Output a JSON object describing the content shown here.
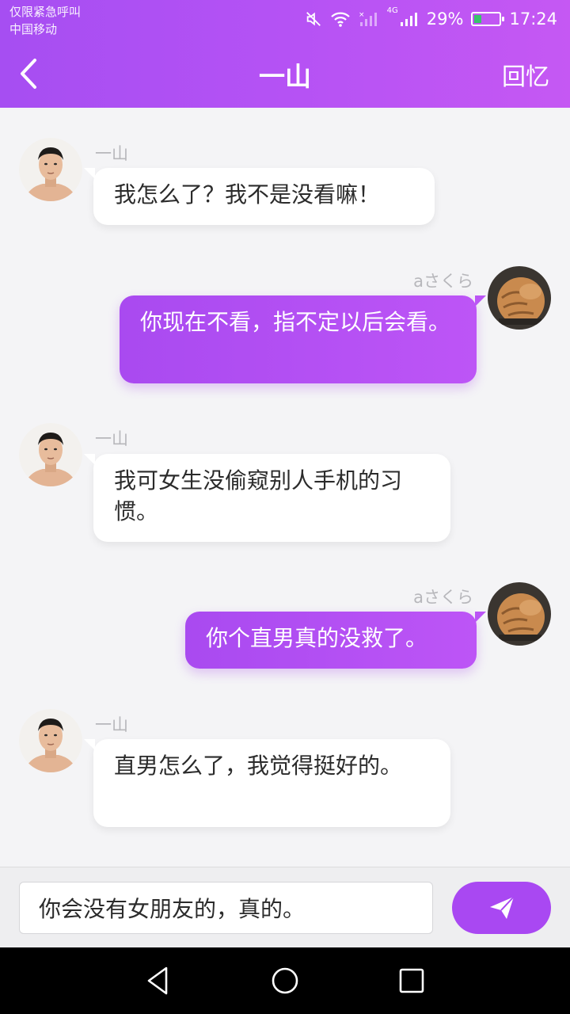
{
  "status_bar": {
    "line1": "仅限紧急呼叫",
    "line2": "中国移动",
    "network": "4G",
    "battery": "29%",
    "time": "17:24",
    "battery_level": 0.29
  },
  "header": {
    "title": "一山",
    "right_action": "回忆"
  },
  "messages": [
    {
      "side": "left",
      "sender": "一山",
      "text": "我怎么了？我不是没看嘛！"
    },
    {
      "side": "right",
      "sender": "aさくら",
      "text": "你现在不看，指不定以后会看。"
    },
    {
      "side": "left",
      "sender": "一山",
      "text": "我可女生没偷窥别人手机的习惯。"
    },
    {
      "side": "right",
      "sender": "aさくら",
      "text": "你个直男真的没救了。"
    },
    {
      "side": "left",
      "sender": "一山",
      "text": "直男怎么了，我觉得挺好的。"
    }
  ],
  "composer": {
    "value": "你会没有女朋友的，真的。"
  },
  "colors": {
    "accent": "#a948f2",
    "header_gradient_start": "#a64ef2",
    "header_gradient_end": "#c558f3"
  },
  "icons": {
    "back": "chevron-left-icon",
    "send": "paper-plane-icon",
    "nav_back": "triangle-back-icon",
    "nav_home": "circle-home-icon",
    "nav_recent": "square-recent-icon"
  }
}
